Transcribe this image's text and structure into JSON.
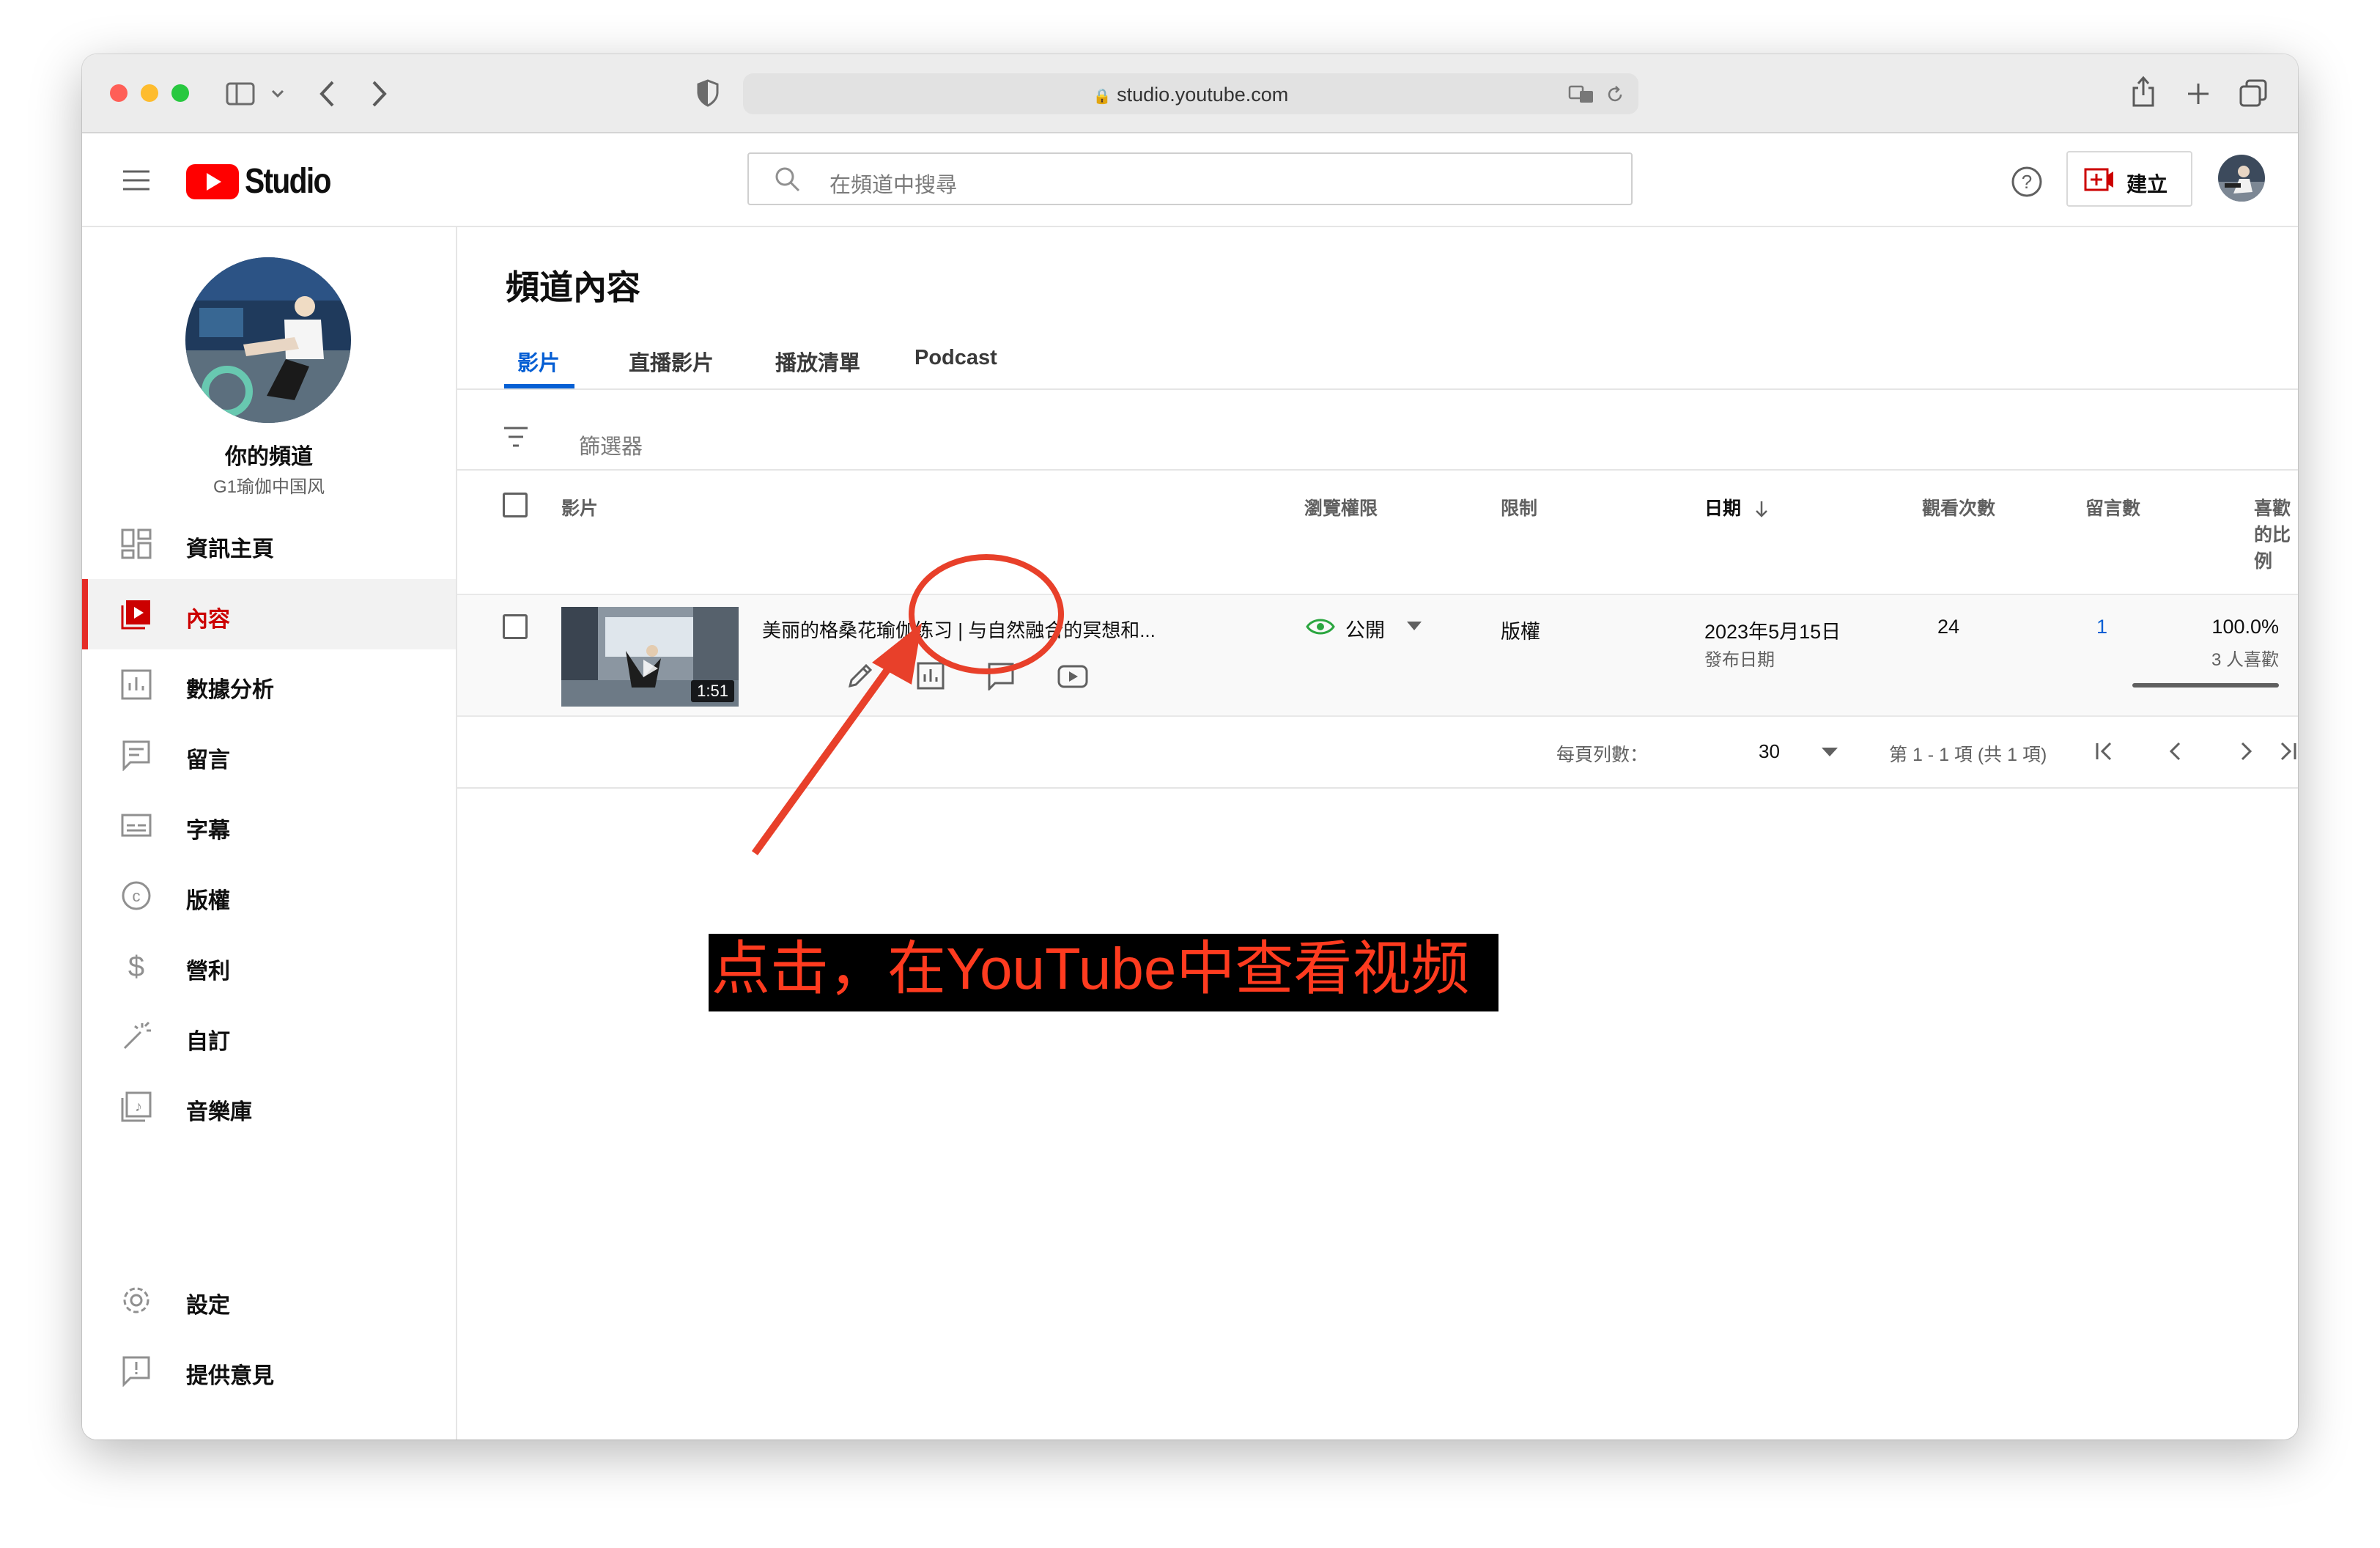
{
  "browser": {
    "url": "studio.youtube.com"
  },
  "header": {
    "logo_text": "Studio",
    "search_placeholder": "在頻道中搜尋",
    "create_label": "建立"
  },
  "channel": {
    "title": "你的頻道",
    "name": "G1瑜伽中国风"
  },
  "sidebar": {
    "items": [
      {
        "label": "資訊主頁",
        "icon": "dashboard-icon"
      },
      {
        "label": "內容",
        "icon": "content-icon",
        "active": true
      },
      {
        "label": "數據分析",
        "icon": "analytics-icon"
      },
      {
        "label": "留言",
        "icon": "comments-icon"
      },
      {
        "label": "字幕",
        "icon": "subtitles-icon"
      },
      {
        "label": "版權",
        "icon": "copyright-icon"
      },
      {
        "label": "營利",
        "icon": "earn-icon"
      },
      {
        "label": "自訂",
        "icon": "customize-icon"
      },
      {
        "label": "音樂庫",
        "icon": "audio-library-icon"
      }
    ],
    "bottom": [
      {
        "label": "設定",
        "icon": "settings-icon"
      },
      {
        "label": "提供意見",
        "icon": "feedback-icon"
      }
    ]
  },
  "main": {
    "title": "頻道內容",
    "tabs": [
      "影片",
      "直播影片",
      "播放清單",
      "Podcast"
    ],
    "active_tab": 0,
    "filter_label": "篩選器",
    "columns": [
      "影片",
      "瀏覽權限",
      "限制",
      "日期",
      "觀看次數",
      "留言數",
      "喜歡的比例"
    ],
    "video": {
      "title": "美丽的格桑花瑜伽练习 | 与自然融合的冥想和...",
      "duration": "1:51",
      "visibility": "公開",
      "restriction": "版權",
      "date": "2023年5月15日",
      "date_note": "發布日期",
      "views": "24",
      "comments": "1",
      "like_ratio": "100.0%",
      "likes_note": "3 人喜歡",
      "like_ratio_value": 1.0
    },
    "pagination": {
      "rows_per_page_label": "每頁列數：",
      "rows_per_page": "30",
      "range": "第 1 - 1 項 (共 1 項)"
    }
  },
  "annotation": {
    "text": "点击，在YouTube中查看视频",
    "color": "#ff3b1f"
  },
  "colors": {
    "brand_red": "#ff0000",
    "active_red": "#cc0000",
    "link_blue": "#065fd4",
    "annotation_red": "#e8402a"
  }
}
